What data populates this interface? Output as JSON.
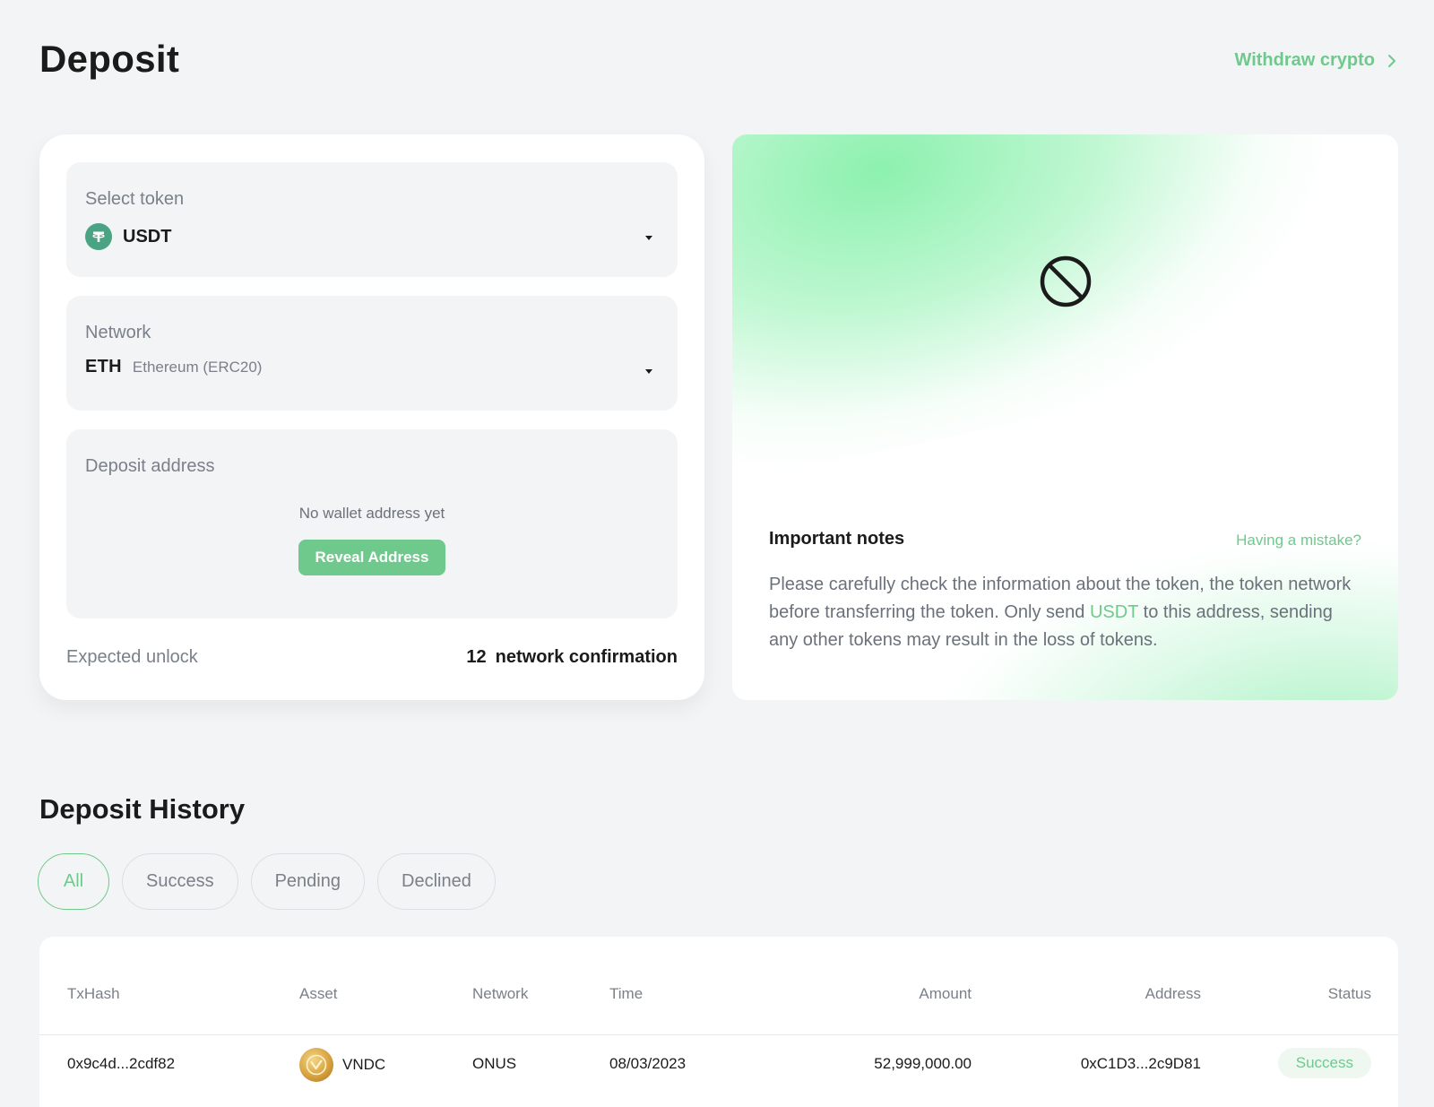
{
  "header": {
    "title": "Deposit",
    "withdraw_label": "Withdraw crypto"
  },
  "deposit_form": {
    "token": {
      "label": "Select token",
      "value": "USDT",
      "icon": "tether-icon"
    },
    "network": {
      "label": "Network",
      "code": "ETH",
      "name": "Ethereum (ERC20)"
    },
    "address": {
      "label": "Deposit address",
      "empty_text": "No wallet address yet",
      "reveal_label": "Reveal Address"
    },
    "unlock": {
      "label": "Expected unlock",
      "count": "12",
      "unit": "network confirmation"
    }
  },
  "notes": {
    "icon": "blocked-icon",
    "title": "Important notes",
    "mistake_label": "Having a mistake?",
    "text_before": "Please carefully check the information about the token, the token network before transferring the token. Only send ",
    "token": "USDT",
    "text_after": " to this address, sending any other tokens may result in the loss of tokens."
  },
  "history": {
    "title": "Deposit History",
    "filters": [
      "All",
      "Success",
      "Pending",
      "Declined"
    ],
    "active_filter": "All",
    "columns": [
      "TxHash",
      "Asset",
      "Network",
      "Time",
      "Amount",
      "Address",
      "Status"
    ],
    "rows": [
      {
        "txhash": "0x9c4d...2cdf82",
        "asset": "VNDC",
        "network": "ONUS",
        "time": "08/03/2023",
        "amount": "52,999,000.00",
        "address": "0xC1D3...2c9D81",
        "status": "Success"
      }
    ]
  },
  "colors": {
    "accent": "#6fc98c",
    "background": "#f3f4f6",
    "muted_text": "#7a808a"
  }
}
